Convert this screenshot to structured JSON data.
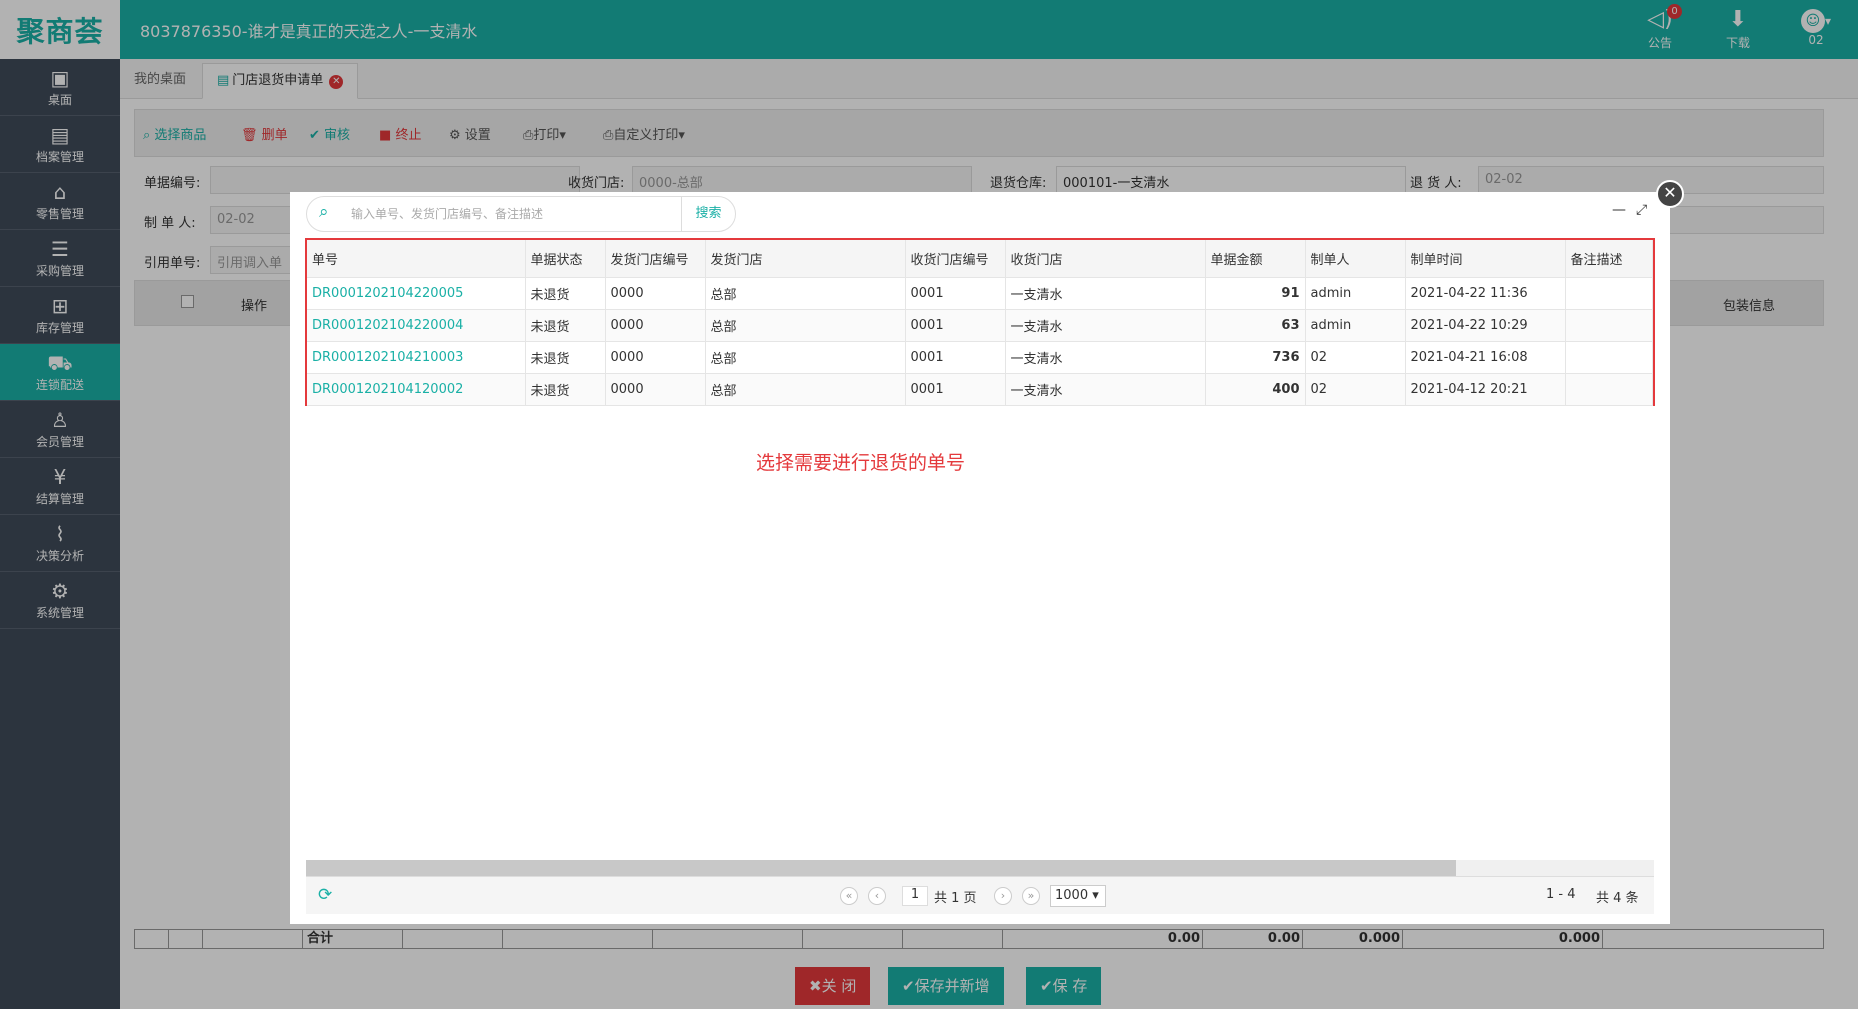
{
  "app": {
    "logo": "聚商荟",
    "store_title": "8037876350-谁才是真正的天选之人-一支清水"
  },
  "top_tools": {
    "announce_label": "公告",
    "announce_count": "0",
    "download_label": "下载",
    "user_label": "02"
  },
  "sidebar": {
    "items": [
      {
        "label": "桌面",
        "icon": "▣"
      },
      {
        "label": "档案管理",
        "icon": "▤"
      },
      {
        "label": "零售管理",
        "icon": "⌂"
      },
      {
        "label": "采购管理",
        "icon": "☰"
      },
      {
        "label": "库存管理",
        "icon": "⊞"
      },
      {
        "label": "连锁配送",
        "icon": "⛟"
      },
      {
        "label": "会员管理",
        "icon": "♙"
      },
      {
        "label": "结算管理",
        "icon": "¥"
      },
      {
        "label": "决策分析",
        "icon": "⌇"
      },
      {
        "label": "系统管理",
        "icon": "⚙"
      }
    ]
  },
  "tabs": {
    "home": "我的桌面",
    "active": "门店退货申请单"
  },
  "toolbar": {
    "select_goods": "选择商品",
    "delete": "删单",
    "audit": "审核",
    "stop": "终止",
    "settings": "设置",
    "print": "打印",
    "custom_print": "自定义打印"
  },
  "form": {
    "doc_no_label": "单据编号:",
    "receive_store_label": "收货门店:",
    "receive_store_value": "0000-总部",
    "return_wh_label": "退货仓库:",
    "return_wh_value": "000101-一支清水",
    "returner_label": "退 货 人:",
    "returner_value": "02-02",
    "maker_label": "制 单 人:",
    "maker_value": "02-02",
    "ref_no_label": "引用单号:",
    "ref_no_placeholder": "引用调入单"
  },
  "grid": {
    "op_header": "操作",
    "pack_header": "包装信息",
    "total_label": "合计",
    "totals": [
      "0.00",
      "0.00",
      "0.000",
      "0.000"
    ]
  },
  "bottom_buttons": {
    "close": "关 闭",
    "save_new": "保存并新增",
    "save": "保 存"
  },
  "modal": {
    "search_placeholder": "输入单号、发货门店编号、备注描述",
    "search_button": "搜索",
    "columns": [
      "单号",
      "单据状态",
      "发货门店编号",
      "发货门店",
      "收货门店编号",
      "收货门店",
      "单据金额",
      "制单人",
      "制单时间",
      "备注描述"
    ],
    "rows": [
      {
        "no": "DR0001202104220005",
        "status": "未退货",
        "from_code": "0000",
        "from_name": "总部",
        "to_code": "0001",
        "to_name": "一支清水",
        "amount": "91",
        "maker": "admin",
        "time": "2021-04-22 11:36",
        "remark": ""
      },
      {
        "no": "DR0001202104220004",
        "status": "未退货",
        "from_code": "0000",
        "from_name": "总部",
        "to_code": "0001",
        "to_name": "一支清水",
        "amount": "63",
        "maker": "admin",
        "time": "2021-04-22 10:29",
        "remark": ""
      },
      {
        "no": "DR0001202104210003",
        "status": "未退货",
        "from_code": "0000",
        "from_name": "总部",
        "to_code": "0001",
        "to_name": "一支清水",
        "amount": "736",
        "maker": "02",
        "time": "2021-04-21 16:08",
        "remark": ""
      },
      {
        "no": "DR0001202104120002",
        "status": "未退货",
        "from_code": "0000",
        "from_name": "总部",
        "to_code": "0001",
        "to_name": "一支清水",
        "amount": "400",
        "maker": "02",
        "time": "2021-04-12 20:21",
        "remark": ""
      }
    ],
    "note": "选择需要进行退货的单号",
    "pager": {
      "page": "1",
      "total_pages": "共 1 页",
      "page_size": "1000",
      "range": "1 - 4",
      "total": "共 4 条"
    }
  }
}
